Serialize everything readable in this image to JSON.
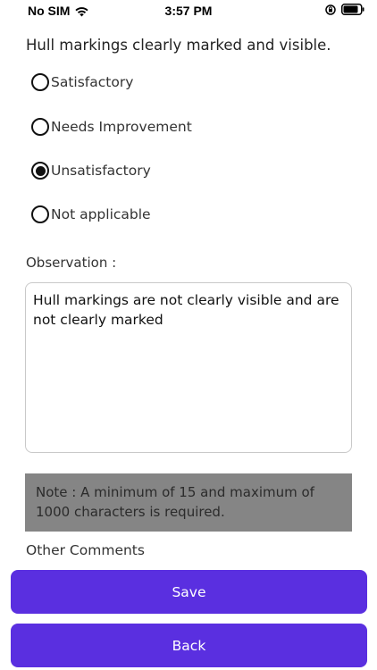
{
  "status_bar": {
    "carrier": "No SIM",
    "time": "3:57 PM",
    "icons": [
      "wifi-icon",
      "orientation-lock-icon",
      "battery-icon"
    ]
  },
  "question": {
    "text": "Hull markings clearly marked and visible."
  },
  "options": [
    {
      "label": "Satisfactory",
      "selected": false
    },
    {
      "label": "Needs Improvement",
      "selected": false
    },
    {
      "label": "Unsatisfactory",
      "selected": true
    },
    {
      "label": "Not applicable",
      "selected": false
    }
  ],
  "observation": {
    "label": "Observation :",
    "value": "Hull markings are not clearly visible and are not clearly marked"
  },
  "note": {
    "text": "Note : A minimum of 15 and maximum of 1000 characters is required."
  },
  "other_comments": {
    "label": "Other Comments"
  },
  "buttons": {
    "save_label": "Save",
    "back_label": "Back"
  },
  "colors": {
    "primary_button": "#5a2fe0",
    "note_background": "#858585"
  }
}
